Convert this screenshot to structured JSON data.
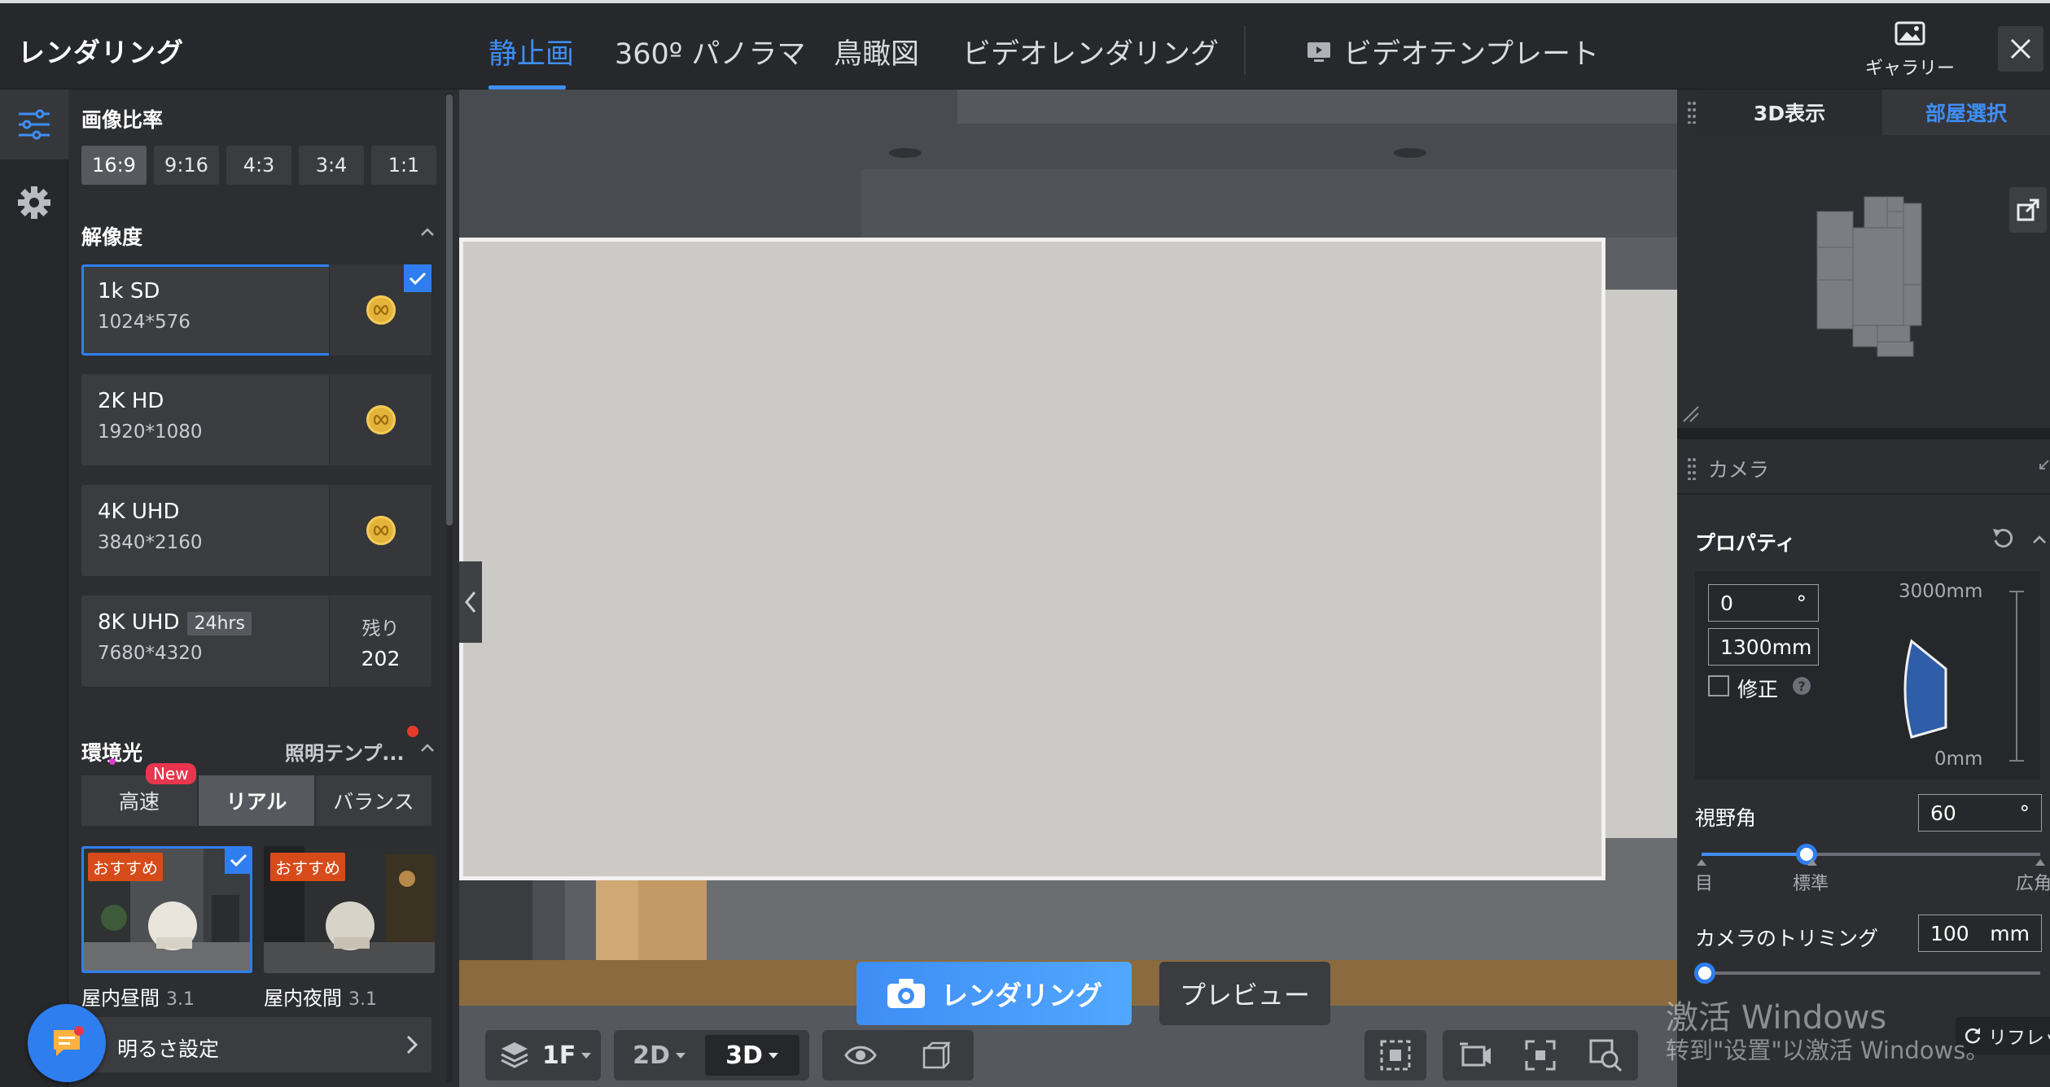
{
  "app": {
    "title": "レンダリング"
  },
  "tabs": [
    {
      "label": "静止画",
      "active": true
    },
    {
      "label": "360º パノラマ"
    },
    {
      "label": "鳥瞰図"
    },
    {
      "label": "ビデオレンダリング"
    }
  ],
  "tab_video_template": "ビデオテンプレート",
  "gallery": {
    "label": "ギャラリー"
  },
  "left": {
    "aspect_title": "画像比率",
    "aspect_options": [
      "16:9",
      "9:16",
      "4:3",
      "3:4",
      "1:1"
    ],
    "aspect_selected": "16:9",
    "resolution_title": "解像度",
    "resolutions": [
      {
        "name": "1k SD",
        "size": "1024*576",
        "selected": true
      },
      {
        "name": "2K HD",
        "size": "1920*1080"
      },
      {
        "name": "4K UHD",
        "size": "3840*2160"
      },
      {
        "name": "8K UHD",
        "tag": "24hrs",
        "size": "7680*4320",
        "remain_label": "残り",
        "remain_value": "202"
      }
    ],
    "env_title": "環境光",
    "lighting_template": "照明テンプ...",
    "modes": [
      {
        "label": "高速",
        "badge": "New"
      },
      {
        "label": "リアル",
        "active": true
      },
      {
        "label": "バランス"
      }
    ],
    "env_presets": [
      {
        "badge": "おすすめ",
        "name": "屋内昼間",
        "version": "3.1",
        "selected": true
      },
      {
        "badge": "おすすめ",
        "name": "屋内夜間",
        "version": "3.1"
      }
    ],
    "brightness_label": "明るさ設定"
  },
  "viewport": {
    "render_button": "レンダリング",
    "preview_button": "プレビュー",
    "floor": "1F",
    "view_2d": "2D",
    "view_3d": "3D"
  },
  "right": {
    "mini_tab_3d": "3D表示",
    "mini_tab_room": "部屋選択",
    "camera_title": "カメラ",
    "properties_title": "プロパティ",
    "angle_value": "0",
    "angle_unit": "°",
    "height_value": "1300mm",
    "correction_label": "修正",
    "height_top": "3000mm",
    "height_bottom": "0mm",
    "fov_label": "視野角",
    "fov_value": "60",
    "fov_unit": "°",
    "fov_level": 0.31,
    "fov_ticks": [
      "目",
      "標準",
      "広角"
    ],
    "trim_label": "カメラのトリミング",
    "trim_value": "100",
    "trim_unit": "mm",
    "trim_level": 0.0,
    "refresh_label": "リフレッ"
  },
  "watermark": {
    "line1": "激活 Windows",
    "line2": "转到\"设置\"以激活 Windows。"
  },
  "colors": {
    "accent": "#3f8ef5",
    "panel": "#2c2e31",
    "recommend": "#d74b1a",
    "coin": "#e4b33a"
  }
}
